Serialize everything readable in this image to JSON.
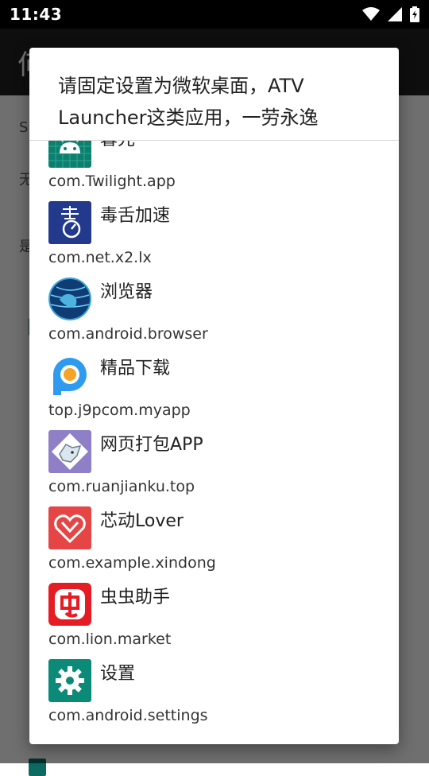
{
  "status_bar": {
    "time": "11:43"
  },
  "background": {
    "appbar_title": "何",
    "labels": [
      "S",
      "无",
      "是"
    ]
  },
  "dialog": {
    "title": "请固定设置为微软桌面，ATV Launcher这类应用，一劳永逸",
    "apps": [
      {
        "name": "暮光",
        "package": "com.Twilight.app",
        "icon": "android-robot-icon"
      },
      {
        "name": "毒舌加速",
        "package": "com.net.x2.lx",
        "icon": "speedometer-icon"
      },
      {
        "name": "浏览器",
        "package": "com.android.browser",
        "icon": "globe-icon"
      },
      {
        "name": "精品下载",
        "package": "top.j9pcom.myapp",
        "icon": "p-logo-icon"
      },
      {
        "name": "网页打包APP",
        "package": "com.ruanjianku.top",
        "icon": "wolf-icon"
      },
      {
        "name": "芯动Lover",
        "package": "com.example.xindong",
        "icon": "heart-icon"
      },
      {
        "name": "虫虫助手",
        "package": "com.lion.market",
        "icon": "bug-logo-icon"
      },
      {
        "name": "设置",
        "package": "com.android.settings",
        "icon": "gear-icon"
      }
    ]
  },
  "colors": {
    "status_bar": "#000000",
    "appbar": "#1f1f1f",
    "scrim": "#000000",
    "accent_teal": "#0b8a78"
  }
}
